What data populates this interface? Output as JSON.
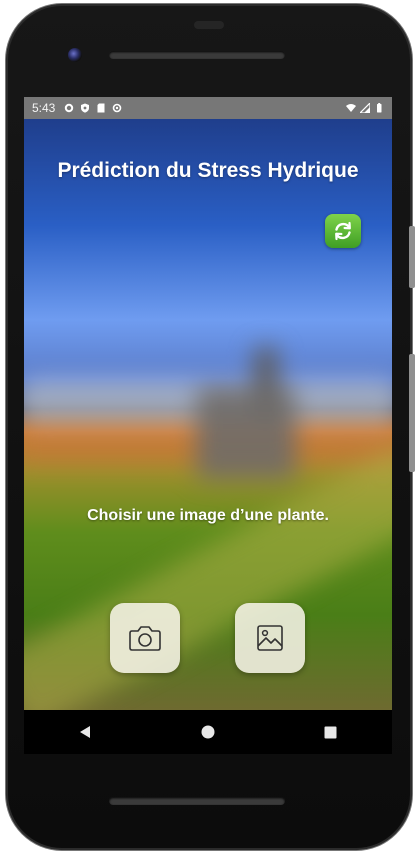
{
  "status_bar": {
    "time": "5:43",
    "left_icons": [
      "settings-icon",
      "shield-icon",
      "sd-card-icon",
      "sync-icon"
    ],
    "right_icons": [
      "wifi-icon",
      "signal-icon",
      "battery-icon"
    ]
  },
  "app": {
    "title": "Prédiction du Stress Hydrique",
    "prompt": "Choisir une image d’une plante.",
    "refresh_icon": "refresh-icon",
    "camera_icon": "camera-icon",
    "gallery_icon": "image-gallery-icon",
    "accent_color": "#4caf2a"
  },
  "nav": {
    "buttons": [
      "back-icon",
      "home-icon",
      "recents-icon"
    ]
  }
}
